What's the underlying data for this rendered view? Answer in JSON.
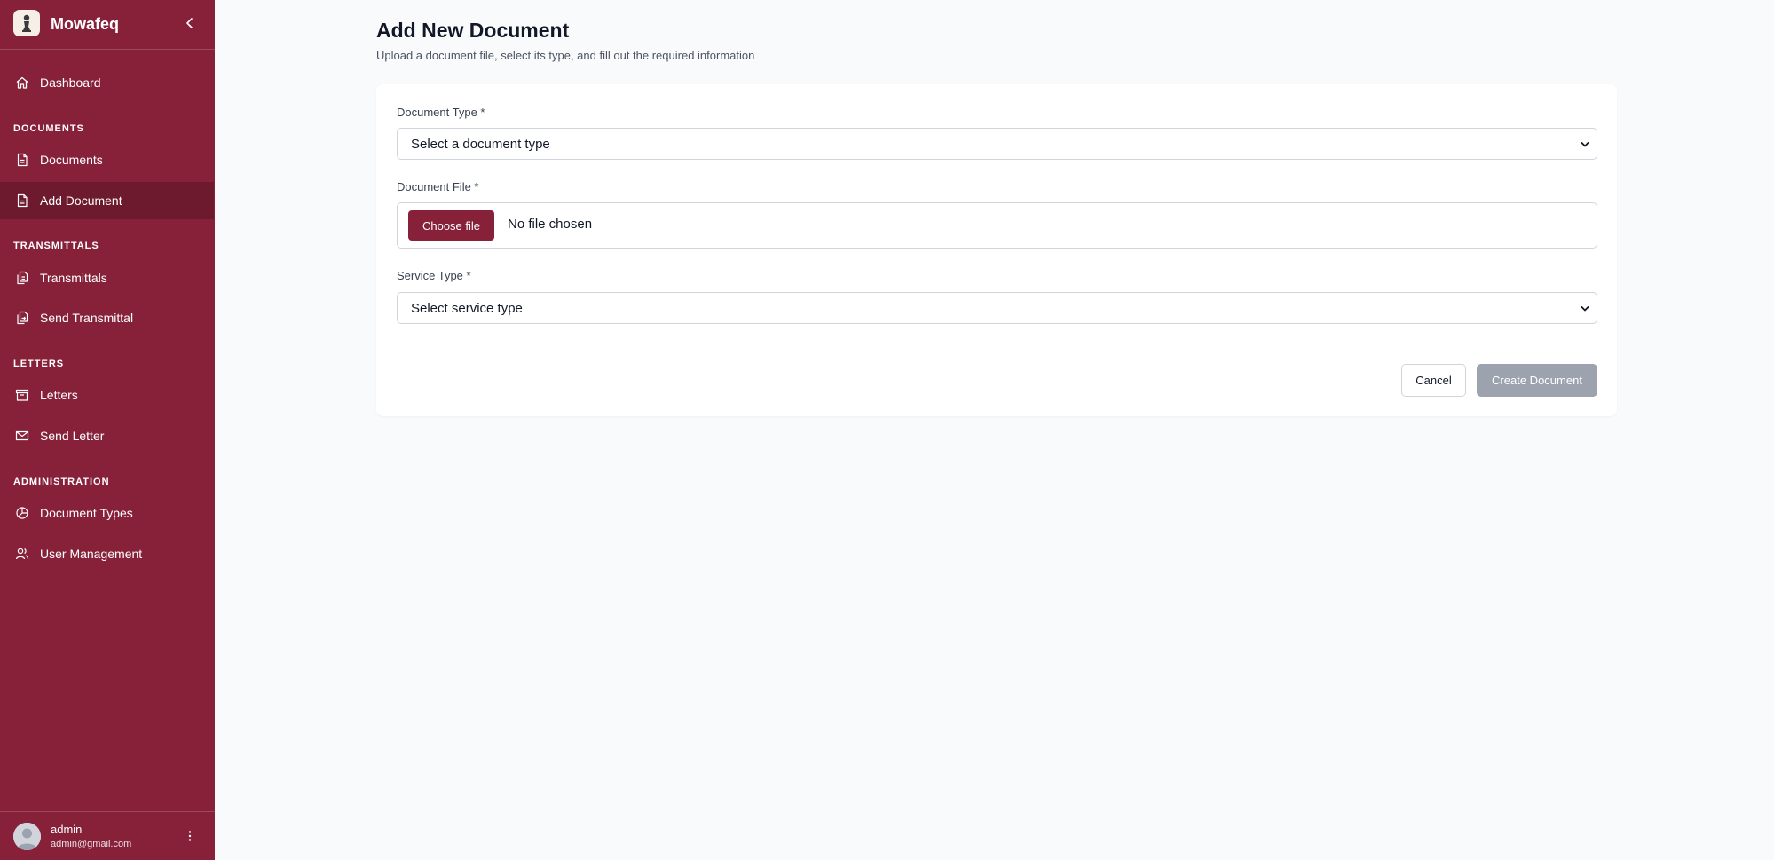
{
  "app": {
    "name": "Mowafeq"
  },
  "sidebar": {
    "dashboard": "Dashboard",
    "sections": {
      "documents": "DOCUMENTS",
      "transmittals": "TRANSMITTALS",
      "letters": "LETTERS",
      "administration": "ADMINISTRATION"
    },
    "items": {
      "documents": "Documents",
      "add_document": "Add Document",
      "transmittals": "Transmittals",
      "send_transmittal": "Send Transmittal",
      "letters": "Letters",
      "send_letter": "Send Letter",
      "document_types": "Document Types",
      "user_management": "User Management"
    },
    "active_item": "add_document"
  },
  "user": {
    "name": "admin",
    "email": "admin@gmail.com"
  },
  "page": {
    "title": "Add New Document",
    "subtitle": "Upload a document file, select its type, and fill out the required information"
  },
  "form": {
    "document_type": {
      "label": "Document Type *",
      "value": "Select a document type"
    },
    "document_file": {
      "label": "Document File *",
      "button": "Choose file",
      "status": "No file chosen"
    },
    "service_type": {
      "label": "Service Type *",
      "value": "Select service type"
    },
    "cancel": "Cancel",
    "submit": "Create Document"
  },
  "colors": {
    "brand": "#862139",
    "brand_active": "#6d1a2e",
    "submit_disabled": "#9ca3af",
    "page_bg": "#f9fafb"
  },
  "icons": {
    "logo": "chess-pawn-icon",
    "collapse": "chevron-left-icon",
    "dashboard": "home-icon",
    "documents": "document-icon",
    "add_document": "document-icon",
    "transmittals": "files-icon",
    "send_transmittal": "files-send-icon",
    "letters": "archive-icon",
    "send_letter": "mail-icon",
    "document_types": "chart-pie-icon",
    "user_management": "users-icon",
    "user_menu": "more-vertical-icon",
    "select_chevron": "chevron-down-icon"
  }
}
